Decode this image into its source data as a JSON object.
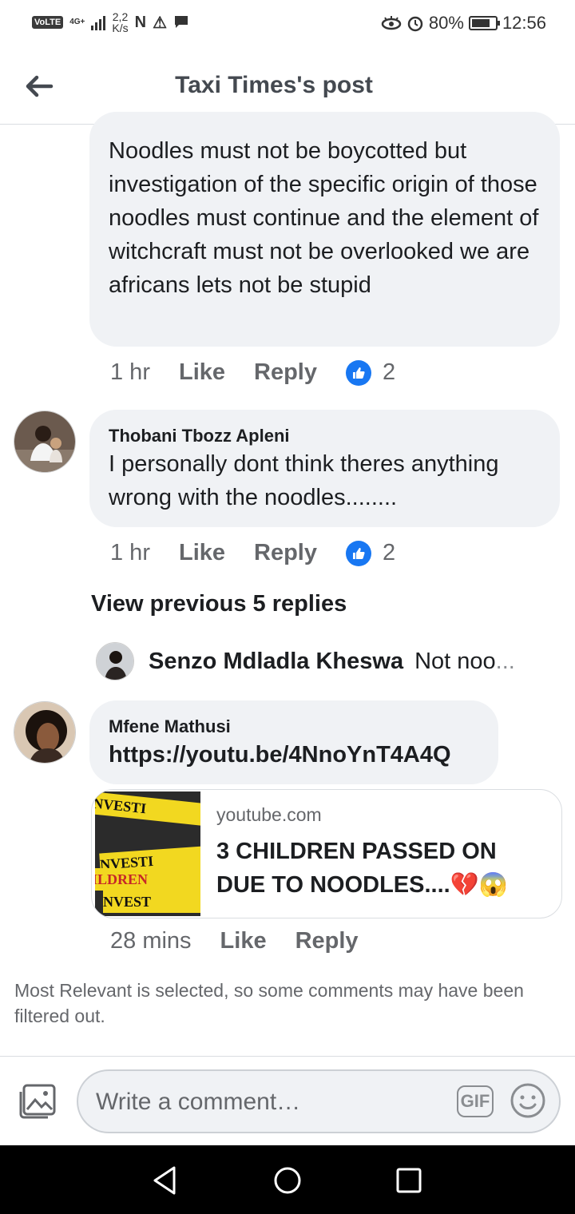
{
  "status_bar": {
    "volte": "VoLTE",
    "network": "4G+",
    "speed_top": "2,2",
    "speed_bottom": "K/s",
    "battery_text": "80%",
    "battery_level": 0.8,
    "time": "12:56",
    "icons": [
      "n-icon",
      "warning-icon",
      "message-icon",
      "eye-icon",
      "alarm-icon"
    ]
  },
  "header": {
    "title": "Taxi Times's post",
    "back_icon": "arrow-left-icon"
  },
  "comments": [
    {
      "text": "Noodles must not be boycotted but investigation of the specific origin of those noodles must continue and the element of witchcraft must not be overlooked we are africans lets not be stupid",
      "time": "1 hr",
      "like": "Like",
      "reply": "Reply",
      "reactions": "2"
    },
    {
      "author": "Thobani Tbozz Apleni",
      "text": "I personally dont think theres anything wrong with the noodles........",
      "time": "1 hr",
      "like": "Like",
      "reply": "Reply",
      "reactions": "2"
    }
  ],
  "view_previous": "View previous 5 replies",
  "reply_preview": {
    "author": "Senzo Mdladla Kheswa",
    "snippet": "Not noo",
    "ellipsis": "..."
  },
  "link_comment": {
    "author": "Mfene Mathusi",
    "text": "https://youtu.be/4NnoYnT4A4Q",
    "card_domain": "youtube.com",
    "card_title": "3 CHILDREN PASSED ON DUE TO NOODLES....💔😱",
    "thumb_tape_1": "INVESTI",
    "thumb_tape_2": "NVESTI",
    "thumb_tape_3": "ILDREN",
    "thumb_tape_4": "NVEST",
    "time": "28 mins",
    "like": "Like",
    "reply": "Reply"
  },
  "filter_note": "Most Relevant is selected, so some comments may have been filtered out.",
  "composer": {
    "placeholder": "Write a comment…",
    "gif_label": "GIF"
  },
  "colors": {
    "bubble": "#f0f2f5",
    "like_blue": "#1877f2",
    "secondary_text": "#65676b"
  }
}
